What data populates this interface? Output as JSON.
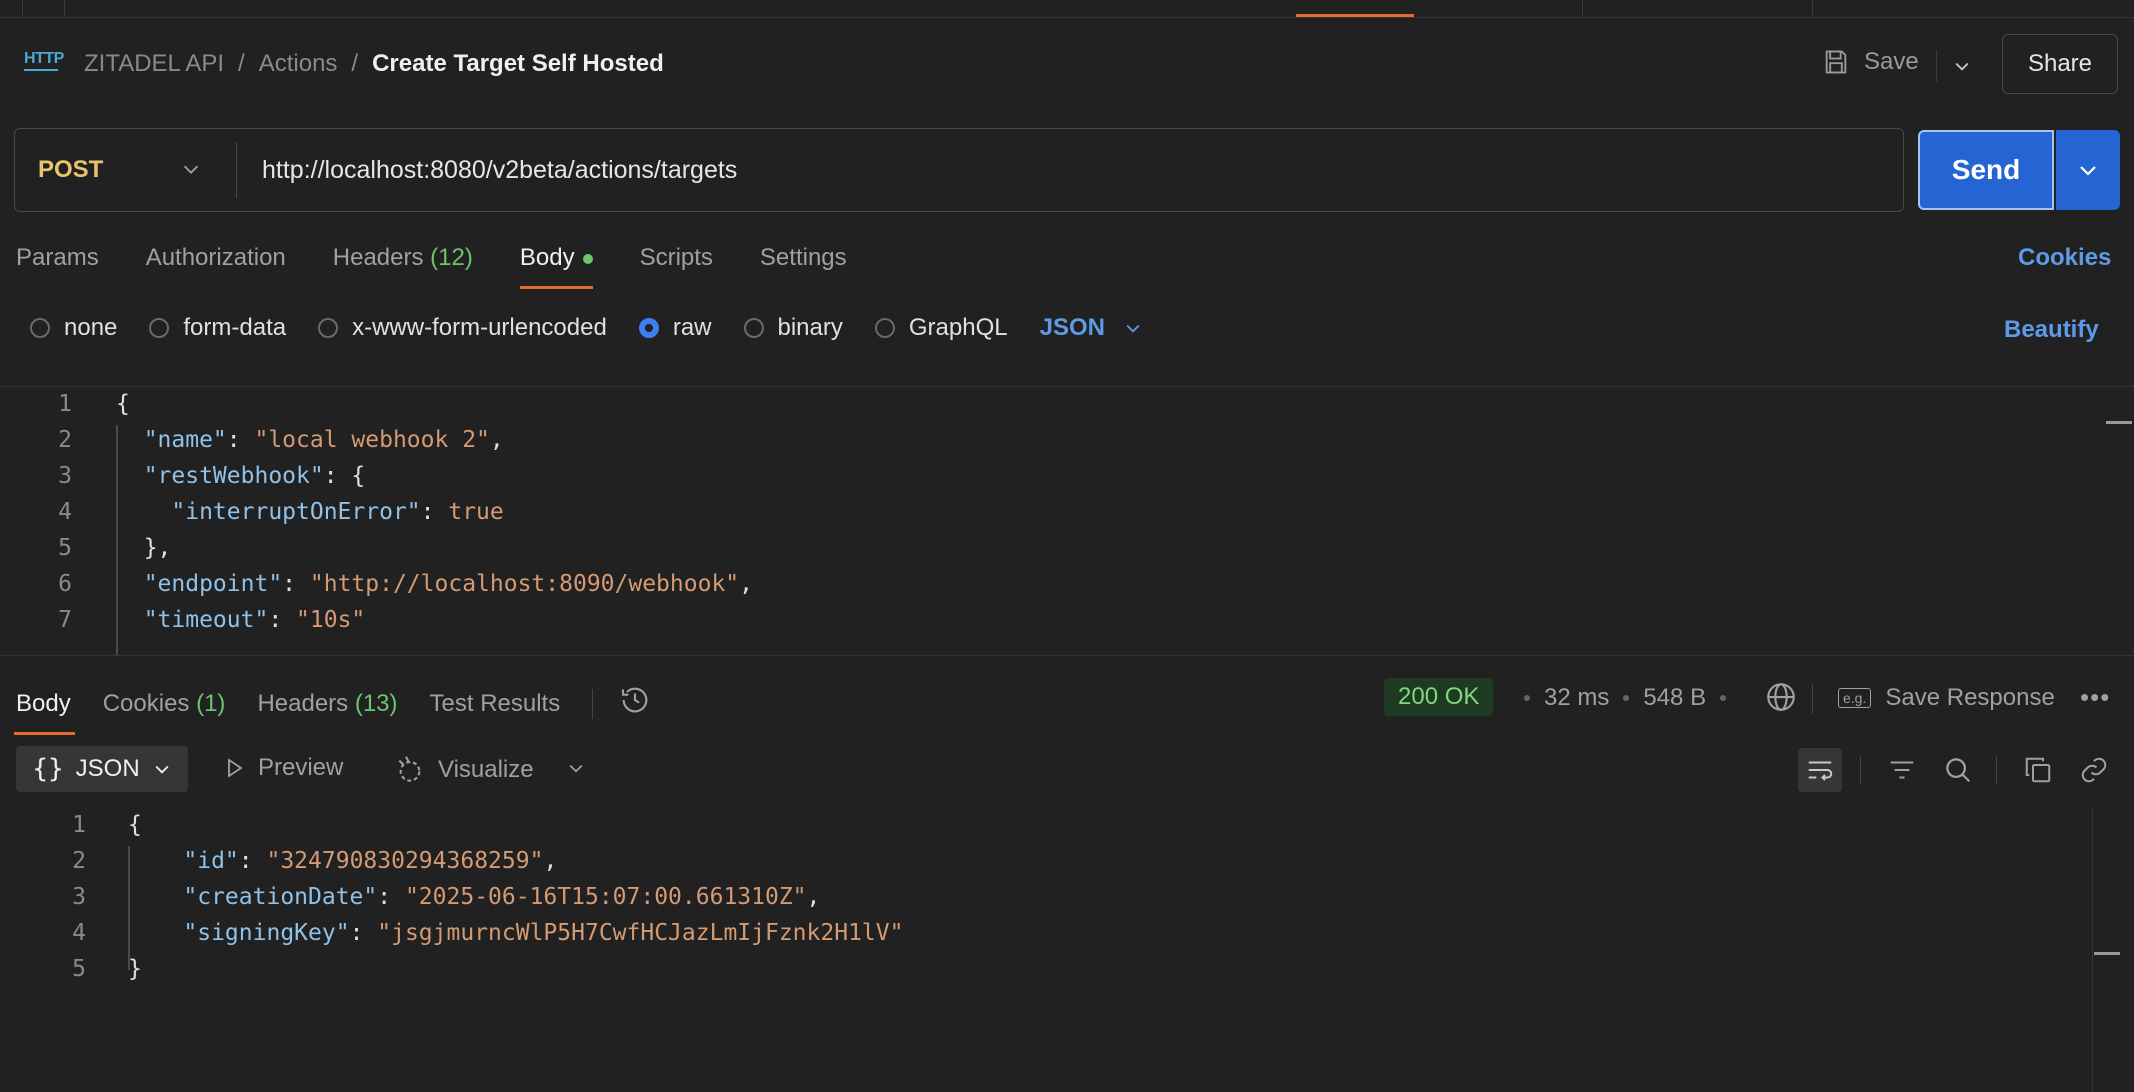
{
  "header": {
    "breadcrumb": [
      "ZITADEL API",
      "/",
      "Actions",
      "/"
    ],
    "title": "Create Target Self Hosted",
    "http_icon_label": "HTTP",
    "save_label": "Save",
    "share_label": "Share"
  },
  "request": {
    "method": "POST",
    "url": "http://localhost:8080/v2beta/actions/targets",
    "send_label": "Send"
  },
  "tabs": [
    {
      "label": "Params"
    },
    {
      "label": "Authorization"
    },
    {
      "label": "Headers",
      "count": "(12)"
    },
    {
      "label": "Body",
      "active": true
    },
    {
      "label": "Scripts"
    },
    {
      "label": "Settings"
    }
  ],
  "cookies_label": "Cookies",
  "body_types": [
    "none",
    "form-data",
    "x-www-form-urlencoded",
    "raw",
    "binary",
    "GraphQL"
  ],
  "body_format": "JSON",
  "beautify_label": "Beautify",
  "request_body": {
    "line_numbers": [
      "1",
      "2",
      "3",
      "4",
      "5",
      "6",
      "7"
    ],
    "lines": [
      [
        [
          "p",
          "{"
        ]
      ],
      [
        [
          "k",
          "  \"name\""
        ],
        [
          "p",
          ": "
        ],
        [
          "s",
          "\"local webhook 2\""
        ],
        [
          "p",
          ","
        ]
      ],
      [
        [
          "k",
          "  \"restWebhook\""
        ],
        [
          "p",
          ": {"
        ]
      ],
      [
        [
          "k",
          "    \"interruptOnError\""
        ],
        [
          "p",
          ": "
        ],
        [
          "b",
          "true"
        ]
      ],
      [
        [
          "p",
          "  },"
        ]
      ],
      [
        [
          "k",
          "  \"endpoint\""
        ],
        [
          "p",
          ": "
        ],
        [
          "s",
          "\"http://localhost:8090/webhook\""
        ],
        [
          "p",
          ","
        ]
      ],
      [
        [
          "k",
          "  \"timeout\""
        ],
        [
          "p",
          ": "
        ],
        [
          "s",
          "\"10s\""
        ]
      ]
    ]
  },
  "response_tabs": [
    {
      "label": "Body",
      "active": true
    },
    {
      "label": "Cookies",
      "count": "(1)"
    },
    {
      "label": "Headers",
      "count": "(13)"
    },
    {
      "label": "Test Results"
    }
  ],
  "response_meta": {
    "status": "200 OK",
    "time": "32 ms",
    "size": "548 B",
    "save_response_label": "Save Response",
    "eg_label": "e.g."
  },
  "response_toolbar": {
    "format": "JSON",
    "preview_label": "Preview",
    "visualize_label": "Visualize"
  },
  "response_body": {
    "line_numbers": [
      "1",
      "2",
      "3",
      "4",
      "5"
    ],
    "lines": [
      [
        [
          "p",
          "{"
        ]
      ],
      [
        [
          "k",
          "    \"id\""
        ],
        [
          "p",
          ": "
        ],
        [
          "s",
          "\"324790830294368259\""
        ],
        [
          "p",
          ","
        ]
      ],
      [
        [
          "k",
          "    \"creationDate\""
        ],
        [
          "p",
          ": "
        ],
        [
          "s",
          "\"2025-06-16T15:07:00.661310Z\""
        ],
        [
          "p",
          ","
        ]
      ],
      [
        [
          "k",
          "    \"signingKey\""
        ],
        [
          "p",
          ": "
        ],
        [
          "s",
          "\"jsgjmurncWlP5H7CwfHCJazLmIjFznk2H1lV\""
        ]
      ],
      [
        [
          "p",
          "}"
        ]
      ]
    ]
  },
  "colors": {
    "accent": "#e66b2f",
    "send": "#2465d3",
    "link": "#5f9ae6",
    "success": "#6cc46c",
    "json_key": "#8fc1e9",
    "json_string": "#d49a73"
  }
}
